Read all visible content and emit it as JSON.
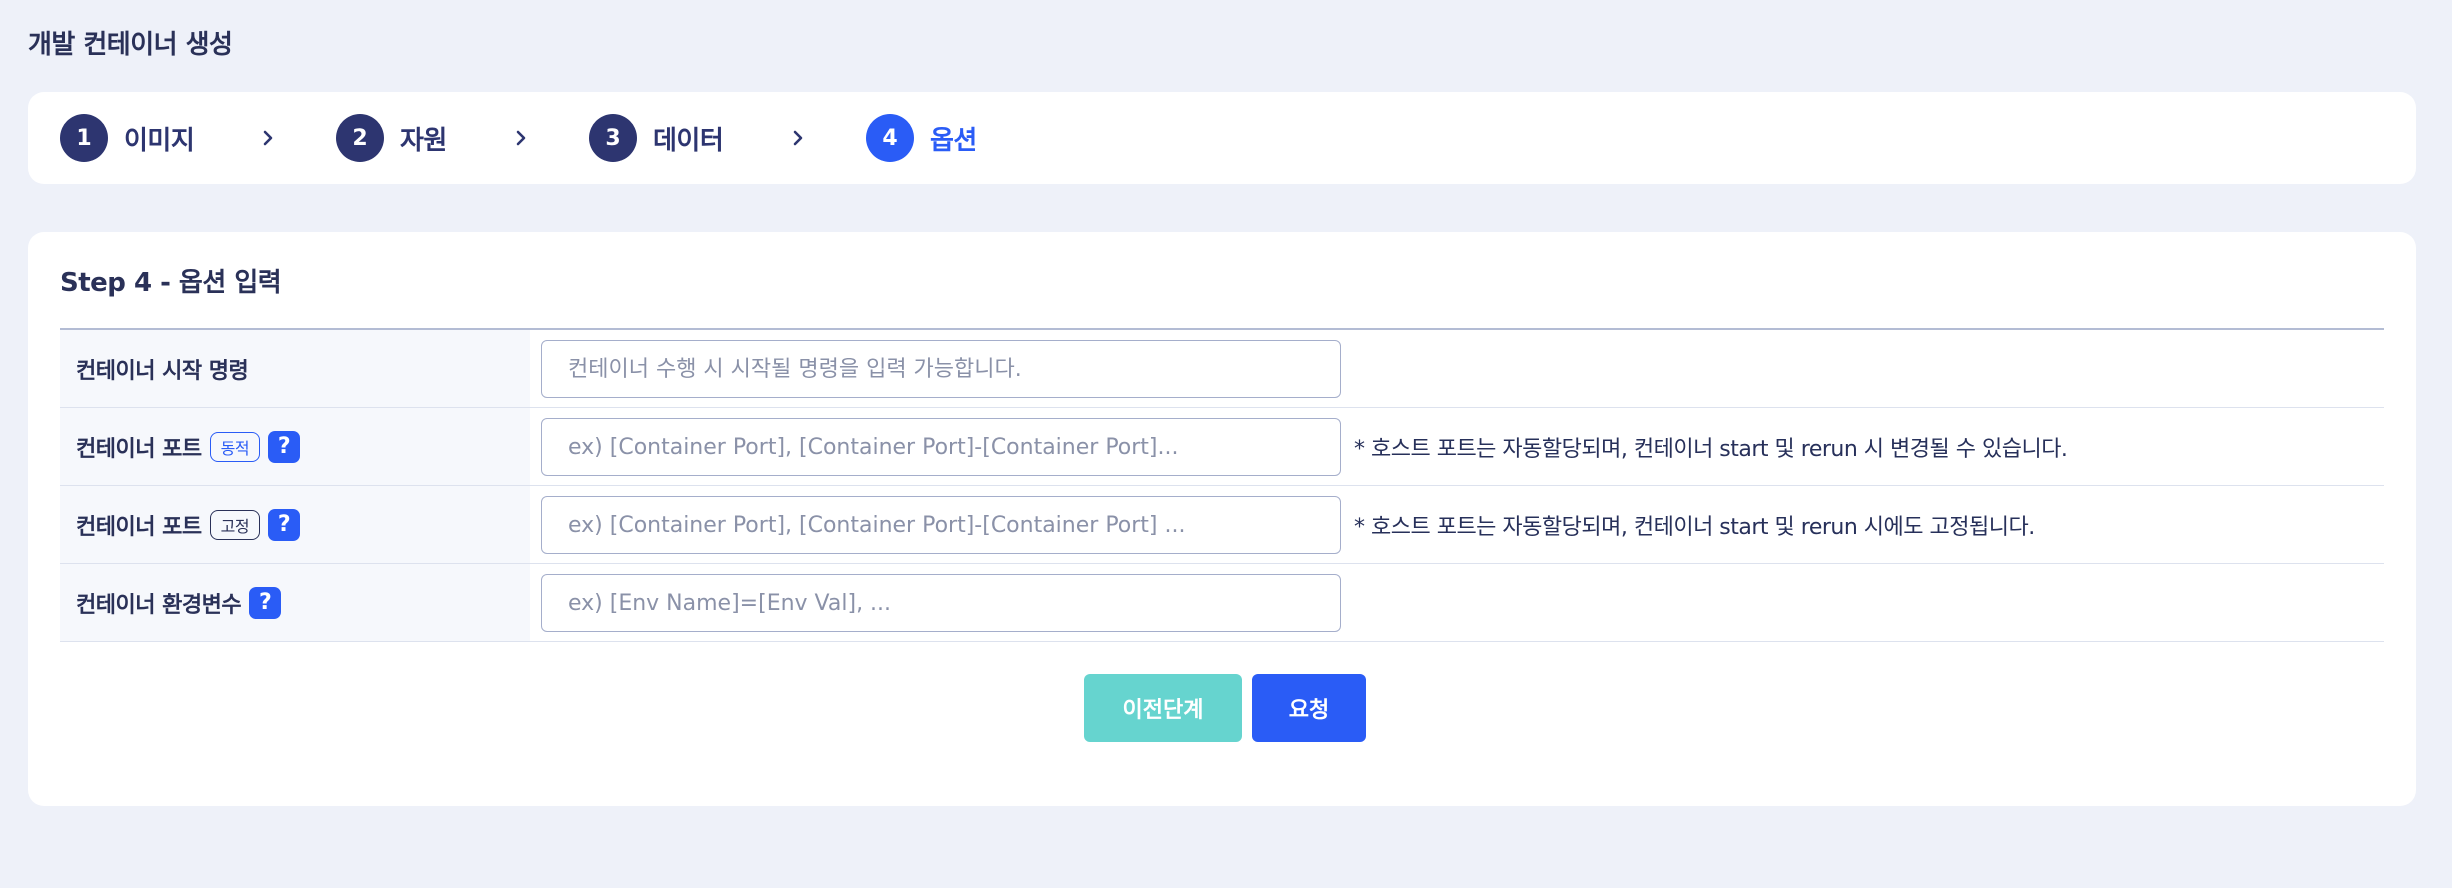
{
  "page": {
    "title": "개발 컨테이너 생성"
  },
  "stepper": {
    "steps": [
      {
        "num": "1",
        "label": "이미지"
      },
      {
        "num": "2",
        "label": "자원"
      },
      {
        "num": "3",
        "label": "데이터"
      },
      {
        "num": "4",
        "label": "옵션"
      }
    ],
    "active_step": 4,
    "separator_icon": "chevron-right-icon"
  },
  "form": {
    "title": "Step 4 - 옵션 입력",
    "rows": [
      {
        "label": "컨테이너 시작 명령",
        "placeholder": "컨테이너 수행 시 시작될 명령을 입력 가능합니다."
      },
      {
        "label": "컨테이너 포트",
        "badge": "동적",
        "help": "?",
        "placeholder": "ex) [Container Port], [Container Port]-[Container Port]...",
        "note": "* 호스트 포트는 자동할당되며, 컨테이너 start 및 rerun 시 변경될 수 있습니다."
      },
      {
        "label": "컨테이너 포트",
        "badge": "고정",
        "help": "?",
        "placeholder": "ex) [Container Port], [Container Port]-[Container Port] ...",
        "note": "* 호스트 포트는 자동할당되며, 컨테이너 start 및 rerun 시에도 고정됩니다."
      },
      {
        "label": "컨테이너 환경변수",
        "help": "?",
        "placeholder": "ex) [Env Name]=[Env Val], ..."
      }
    ]
  },
  "actions": {
    "prev_label": "이전단계",
    "submit_label": "요청"
  },
  "colors": {
    "accent": "#2a5cf6",
    "step_inactive": "#2d3570",
    "prev_button": "#66d4cf",
    "background": "#eef1f9"
  }
}
